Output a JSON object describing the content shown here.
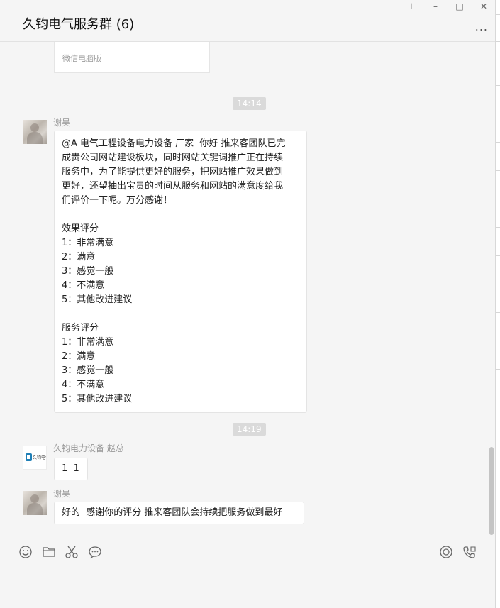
{
  "window": {
    "title": "久钧电气服务群 (6)",
    "controls": {
      "pin": "⊥",
      "minimize": "–",
      "maximize": "□",
      "close": "✕"
    },
    "more": "..."
  },
  "card_fragment": {
    "footer": "微信电脑版"
  },
  "messages": [
    {
      "type": "time",
      "text": "14:14"
    },
    {
      "type": "message",
      "sender": "谢昊",
      "avatar": "person-photo",
      "lines": [
        "@A 电气工程设备电力设备 厂家  你好 推来客团队已完",
        "成贵公司网站建设板块，同时网站关键词推广正在持续",
        "服务中，为了能提供更好的服务，把网站推广效果做到",
        "更好，还望抽出宝贵的时间从服务和网站的满意度给我",
        "们评价一下呢。万分感谢！",
        "",
        "效果评分",
        "1：非常满意",
        "2：满意",
        "3：感觉一般",
        "4：不满意",
        "5：其他改进建议",
        "",
        "服务评分",
        "1：非常满意",
        "2：满意",
        "3：感觉一般",
        "4：不满意",
        "5：其他改进建议"
      ]
    },
    {
      "type": "time",
      "text": "14:19"
    },
    {
      "type": "message",
      "sender": "久钧电力设备 赵总",
      "avatar": "company-logo",
      "avatar_text": "久钧电气",
      "lines": [
        "1  1"
      ]
    },
    {
      "type": "message",
      "sender": "谢昊",
      "avatar": "person-photo",
      "lines": [
        "好的  感谢你的评分 推来客团队会持续把服务做到最好"
      ]
    }
  ],
  "toolbar": {
    "left": [
      "emoji-icon",
      "folder-icon",
      "scissors-icon",
      "chat-history-icon"
    ],
    "right": [
      "live-icon",
      "voice-call-icon"
    ]
  },
  "colors": {
    "background": "#f5f5f5",
    "bubble": "#ffffff",
    "time_badge": "#dadada",
    "accent": "#1e9b4a"
  }
}
